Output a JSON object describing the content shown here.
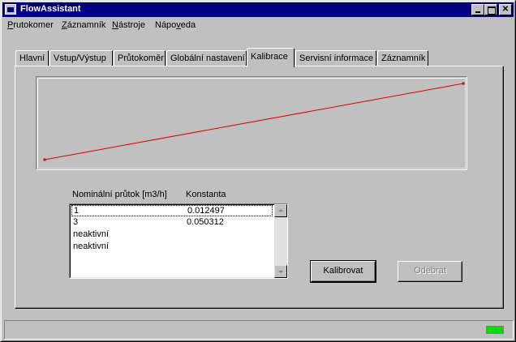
{
  "window": {
    "title": "FlowAssistant"
  },
  "menu": [
    {
      "label": "Prutokomer",
      "accel": "P"
    },
    {
      "label": "Záznamník",
      "accel": "Z"
    },
    {
      "label": "Nástroje",
      "accel": "N"
    },
    {
      "label": "Nápoveda",
      "accel": "v"
    }
  ],
  "tabs": [
    {
      "label": "Hlavní"
    },
    {
      "label": "Vstup/Výstup"
    },
    {
      "label": "Průtokoměr"
    },
    {
      "label": "Globální nastavení"
    },
    {
      "label": "Kalibrace",
      "active": true
    },
    {
      "label": "Servisní informace"
    },
    {
      "label": "Záznamník"
    }
  ],
  "chart_data": {
    "type": "line",
    "line_color": "#e00000",
    "series": [
      {
        "points": [
          [
            0,
            0
          ],
          [
            1,
            1
          ]
        ]
      }
    ]
  },
  "table": {
    "headers": [
      "Nominální průtok [m3/h]",
      "Konstanta"
    ],
    "rows": [
      [
        "1",
        "0.012497"
      ],
      [
        "3",
        "0.050312"
      ],
      [
        "neaktivní",
        ""
      ],
      [
        "neaktivní",
        ""
      ]
    ]
  },
  "buttons": {
    "calibrate": "Kalibrovat",
    "remove": "Odebrat"
  },
  "status": {
    "indicator_color": "#00e000"
  }
}
